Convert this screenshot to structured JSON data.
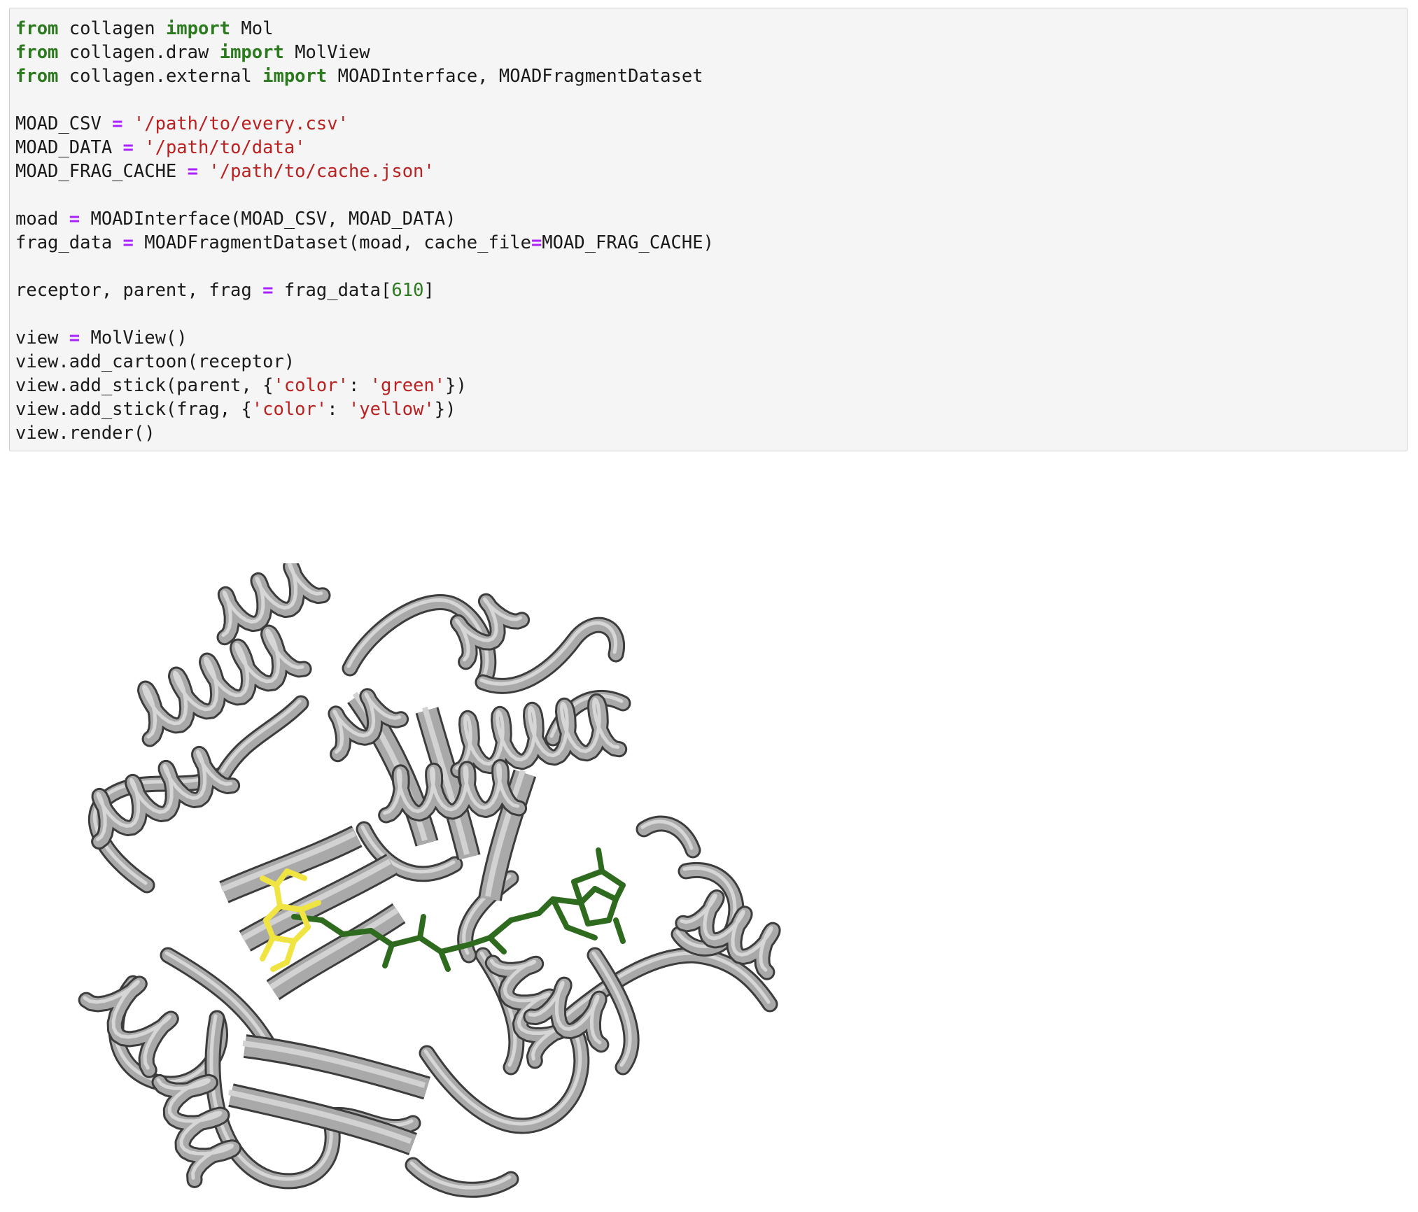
{
  "cell": {
    "code_lines": [
      [
        {
          "t": "kw",
          "v": "from"
        },
        {
          "t": "plain",
          "v": " collagen "
        },
        {
          "t": "kw",
          "v": "import"
        },
        {
          "t": "plain",
          "v": " Mol"
        }
      ],
      [
        {
          "t": "kw",
          "v": "from"
        },
        {
          "t": "plain",
          "v": " collagen.draw "
        },
        {
          "t": "kw",
          "v": "import"
        },
        {
          "t": "plain",
          "v": " MolView"
        }
      ],
      [
        {
          "t": "kw",
          "v": "from"
        },
        {
          "t": "plain",
          "v": " collagen.external "
        },
        {
          "t": "kw",
          "v": "import"
        },
        {
          "t": "plain",
          "v": " MOADInterface, MOADFragmentDataset"
        }
      ],
      [],
      [
        {
          "t": "plain",
          "v": "MOAD_CSV "
        },
        {
          "t": "op",
          "v": "="
        },
        {
          "t": "plain",
          "v": " "
        },
        {
          "t": "str",
          "v": "'/path/to/every.csv'"
        }
      ],
      [
        {
          "t": "plain",
          "v": "MOAD_DATA "
        },
        {
          "t": "op",
          "v": "="
        },
        {
          "t": "plain",
          "v": " "
        },
        {
          "t": "str",
          "v": "'/path/to/data'"
        }
      ],
      [
        {
          "t": "plain",
          "v": "MOAD_FRAG_CACHE "
        },
        {
          "t": "op",
          "v": "="
        },
        {
          "t": "plain",
          "v": " "
        },
        {
          "t": "str",
          "v": "'/path/to/cache.json'"
        }
      ],
      [],
      [
        {
          "t": "plain",
          "v": "moad "
        },
        {
          "t": "op",
          "v": "="
        },
        {
          "t": "plain",
          "v": " MOADInterface(MOAD_CSV, MOAD_DATA)"
        }
      ],
      [
        {
          "t": "plain",
          "v": "frag_data "
        },
        {
          "t": "op",
          "v": "="
        },
        {
          "t": "plain",
          "v": " MOADFragmentDataset(moad, cache_file"
        },
        {
          "t": "op",
          "v": "="
        },
        {
          "t": "plain",
          "v": "MOAD_FRAG_CACHE)"
        }
      ],
      [],
      [
        {
          "t": "plain",
          "v": "receptor, parent, frag "
        },
        {
          "t": "op",
          "v": "="
        },
        {
          "t": "plain",
          "v": " frag_data["
        },
        {
          "t": "num",
          "v": "610"
        },
        {
          "t": "plain",
          "v": "]"
        }
      ],
      [],
      [
        {
          "t": "plain",
          "v": "view "
        },
        {
          "t": "op",
          "v": "="
        },
        {
          "t": "plain",
          "v": " MolView()"
        }
      ],
      [
        {
          "t": "plain",
          "v": "view.add_cartoon(receptor)"
        }
      ],
      [
        {
          "t": "plain",
          "v": "view.add_stick(parent, {"
        },
        {
          "t": "str",
          "v": "'color'"
        },
        {
          "t": "plain",
          "v": ": "
        },
        {
          "t": "str",
          "v": "'green'"
        },
        {
          "t": "plain",
          "v": "})"
        }
      ],
      [
        {
          "t": "plain",
          "v": "view.add_stick(frag, {"
        },
        {
          "t": "str",
          "v": "'color'"
        },
        {
          "t": "plain",
          "v": ": "
        },
        {
          "t": "str",
          "v": "'yellow'"
        },
        {
          "t": "plain",
          "v": "})"
        }
      ],
      [
        {
          "t": "plain",
          "v": "view.render()"
        }
      ]
    ]
  },
  "output": {
    "viewer": {
      "receptor_color": "#a9a9a9",
      "parent_color": "#2e6b1f",
      "fragment_color": "#f0e442"
    }
  }
}
